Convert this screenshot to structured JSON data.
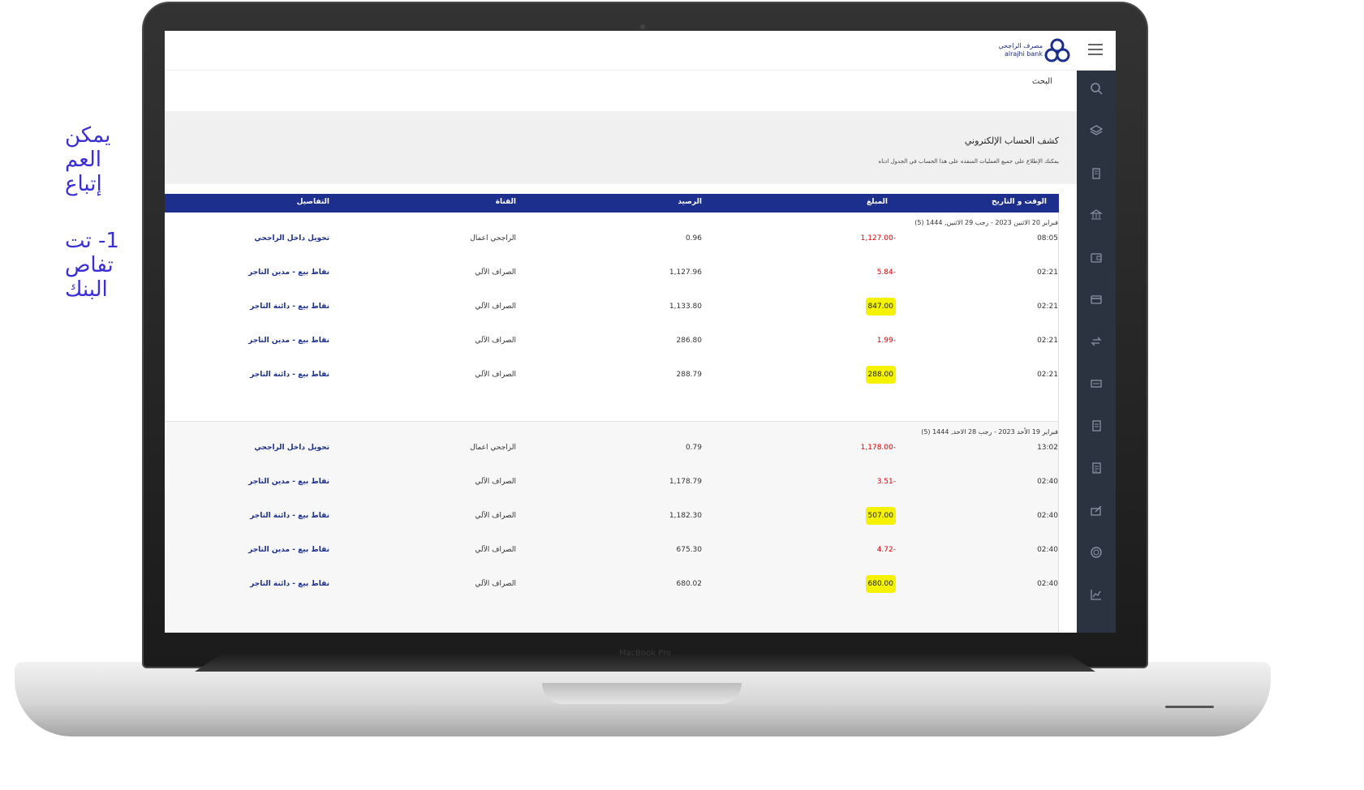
{
  "side_text": {
    "lines": [
      "يمكن",
      "العم",
      "إتباع"
    ],
    "lines2": [
      "1- تت",
      "تفاص",
      "البنك"
    ]
  },
  "bezel_label": "MacBook Pro",
  "colors": {
    "brand": "#1d2f8c",
    "sidebar": "#2b3340",
    "negative": "#e00000",
    "highlight": "#f5f200",
    "side_text": "#3a2fd6"
  },
  "app": {
    "logo_ar": "مصرف الراجحي",
    "logo_en": "alrajhi bank",
    "search_label": "البحث",
    "statement_title": "كشف الحساب الإلكتروني",
    "statement_desc": "يمكنك الإطلاع على جميع العمليات المنفذه على هذا الحساب في الجدول ادناه"
  },
  "sidebar_icons": [
    "search-icon",
    "layers-icon",
    "building-icon",
    "bank-icon",
    "wallet-icon",
    "card-icon",
    "transfer-icon",
    "bill-icon",
    "document-icon",
    "document2-icon",
    "sign-icon",
    "coin-icon",
    "chart-icon"
  ],
  "table": {
    "headers": {
      "datetime": "الوقت و التاريخ",
      "amount": "المبلغ",
      "balance": "الرصيد",
      "channel": "القناة",
      "details": "التفاصيل"
    },
    "groups": [
      {
        "date": "فبراير 20 الاثنين 2023 - رجب 29 الاثنين, 1444 (5)",
        "rows": [
          {
            "time": "08:05",
            "amount": "1,127.00-",
            "sign": "neg",
            "balance": "0.96",
            "channel": "الراجحي اعمال",
            "details": "تحويل داخل الراجحي"
          },
          {
            "time": "02:21",
            "amount": "5.84-",
            "sign": "neg",
            "balance": "1,127.96",
            "channel": "الصراف الآلي",
            "details": "نقاط بيع - مدين التاجر"
          },
          {
            "time": "02:21",
            "amount": "847.00",
            "sign": "pos",
            "balance": "1,133.80",
            "channel": "الصراف الآلي",
            "details": "نقاط بيع - دائنة التاجر"
          },
          {
            "time": "02:21",
            "amount": "1.99-",
            "sign": "neg",
            "balance": "286.80",
            "channel": "الصراف الآلي",
            "details": "نقاط بيع - مدين التاجر"
          },
          {
            "time": "02:21",
            "amount": "288.00",
            "sign": "pos",
            "balance": "288.79",
            "channel": "الصراف الآلي",
            "details": "نقاط بيع - دائنة التاجر"
          }
        ]
      },
      {
        "date": "فبراير 19 الأحد 2023 - رجب 28 الاحد, 1444 (5)",
        "rows": [
          {
            "time": "13:02",
            "amount": "1,178.00-",
            "sign": "neg",
            "balance": "0.79",
            "channel": "الراجحي اعمال",
            "details": "تحويل داخل الراجحي"
          },
          {
            "time": "02:40",
            "amount": "3.51-",
            "sign": "neg",
            "balance": "1,178.79",
            "channel": "الصراف الآلي",
            "details": "نقاط بيع - مدين التاجر"
          },
          {
            "time": "02:40",
            "amount": "507.00",
            "sign": "pos",
            "balance": "1,182.30",
            "channel": "الصراف الآلي",
            "details": "نقاط بيع - دائنة التاجر"
          },
          {
            "time": "02:40",
            "amount": "4.72-",
            "sign": "neg",
            "balance": "675.30",
            "channel": "الصراف الآلي",
            "details": "نقاط بيع - مدين التاجر"
          },
          {
            "time": "02:40",
            "amount": "680.00",
            "sign": "pos",
            "balance": "680.02",
            "channel": "الصراف الآلي",
            "details": "نقاط بيع - دائنة التاجر"
          }
        ]
      }
    ]
  }
}
